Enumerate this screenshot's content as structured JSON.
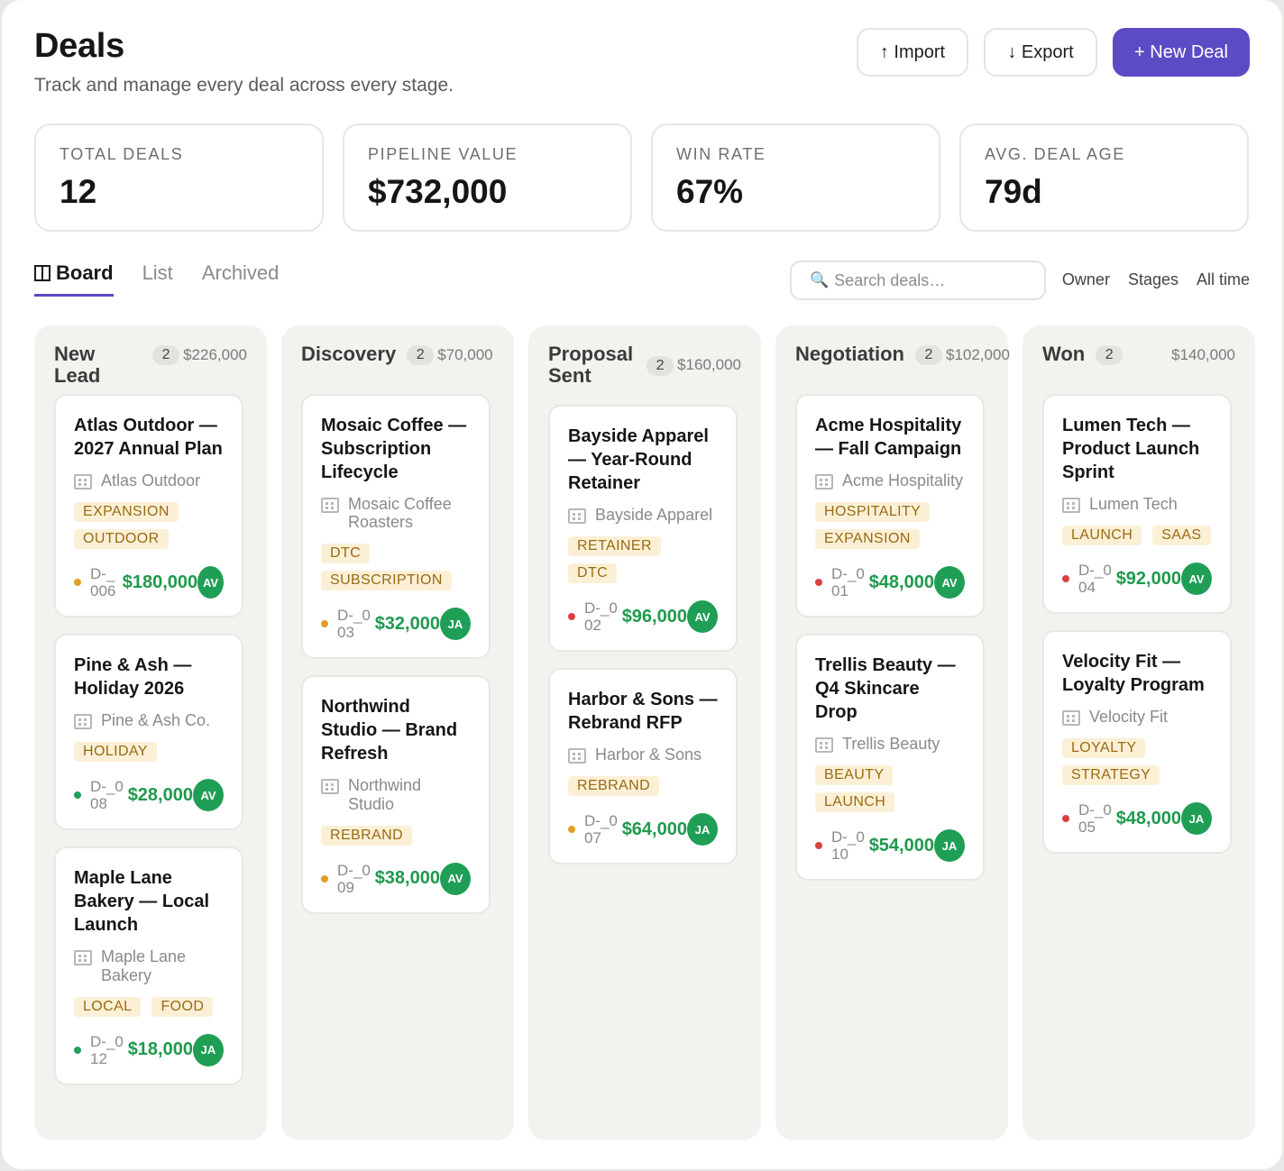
{
  "header": {
    "title": "Deals",
    "subtitle": "Track and manage every deal across every stage."
  },
  "actions": {
    "import_label": "↑ Import",
    "export_label": "↓ Export",
    "new_deal_label": "+ New Deal"
  },
  "stats": [
    {
      "label": "TOTAL DEALS",
      "value": "12"
    },
    {
      "label": "PIPELINE VALUE",
      "value": "$732,000"
    },
    {
      "label": "WIN RATE",
      "value": "67%"
    },
    {
      "label": "AVG. DEAL AGE",
      "value": "79d"
    }
  ],
  "tabs": [
    {
      "label": "Board",
      "active": true
    },
    {
      "label": "List",
      "active": false
    },
    {
      "label": "Archived",
      "active": false
    }
  ],
  "search": {
    "placeholder": "Search deals…"
  },
  "filters": [
    "Owner",
    "Stages",
    "All time"
  ],
  "colors": {
    "accent": "#5b4bc4",
    "money": "#1e9a4d",
    "tag_bg": "#fbf0d6",
    "tag_text": "#9a6a12"
  },
  "columns": [
    {
      "title": "New Lead",
      "count": "2",
      "amount": "$226,000",
      "cards": [
        {
          "title": "Atlas Outdoor — 2027 Annual Plan",
          "company": "Atlas Outdoor",
          "tags": [
            "EXPANSION",
            "OUTDOOR"
          ],
          "status": "yellow",
          "id": "D-_006",
          "amount": "$180,000",
          "owner": "AV"
        },
        {
          "title": "Pine & Ash — Holiday 2026",
          "company": "Pine & Ash Co.",
          "tags": [
            "HOLIDAY"
          ],
          "status": "green",
          "id": "D-_008",
          "amount": "$28,000",
          "owner": "AV"
        },
        {
          "title": "Maple Lane Bakery — Local Launch",
          "company": "Maple Lane Bakery",
          "tags": [
            "LOCAL",
            "FOOD"
          ],
          "status": "green",
          "id": "D-_012",
          "amount": "$18,000",
          "owner": "JA"
        }
      ]
    },
    {
      "title": "Discovery",
      "count": "2",
      "amount": "$70,000",
      "cards": [
        {
          "title": "Mosaic Coffee — Subscription Lifecycle",
          "company": "Mosaic Coffee Roasters",
          "tags": [
            "DTC",
            "SUBSCRIPTION"
          ],
          "status": "yellow",
          "id": "D-_003",
          "amount": "$32,000",
          "owner": "JA"
        },
        {
          "title": "Northwind Studio — Brand Refresh",
          "company": "Northwind Studio",
          "tags": [
            "REBRAND"
          ],
          "status": "yellow",
          "id": "D-_009",
          "amount": "$38,000",
          "owner": "AV"
        }
      ]
    },
    {
      "title": "Proposal Sent",
      "count": "2",
      "amount": "$160,000",
      "cards": [
        {
          "title": "Bayside Apparel — Year-Round Retainer",
          "company": "Bayside Apparel",
          "tags": [
            "RETAINER",
            "DTC"
          ],
          "status": "red",
          "id": "D-_002",
          "amount": "$96,000",
          "owner": "AV"
        },
        {
          "title": "Harbor & Sons — Rebrand RFP",
          "company": "Harbor & Sons",
          "tags": [
            "REBRAND"
          ],
          "status": "yellow",
          "id": "D-_007",
          "amount": "$64,000",
          "owner": "JA"
        }
      ]
    },
    {
      "title": "Negotiation",
      "count": "2",
      "amount": "$102,000",
      "cards": [
        {
          "title": "Acme Hospitality — Fall Campaign",
          "company": "Acme Hospitality",
          "tags": [
            "HOSPITALITY",
            "EXPANSION"
          ],
          "status": "red",
          "id": "D-_001",
          "amount": "$48,000",
          "owner": "AV"
        },
        {
          "title": "Trellis Beauty — Q4 Skincare Drop",
          "company": "Trellis Beauty",
          "tags": [
            "BEAUTY",
            "LAUNCH"
          ],
          "status": "red",
          "id": "D-_010",
          "amount": "$54,000",
          "owner": "JA"
        }
      ]
    },
    {
      "title": "Won",
      "count": "2",
      "amount": "$140,000",
      "cards": [
        {
          "title": "Lumen Tech — Product Launch Sprint",
          "company": "Lumen Tech",
          "tags": [
            "LAUNCH",
            "SAAS"
          ],
          "status": "red",
          "id": "D-_004",
          "amount": "$92,000",
          "owner": "AV"
        },
        {
          "title": "Velocity Fit — Loyalty Program",
          "company": "Velocity Fit",
          "tags": [
            "LOYALTY",
            "STRATEGY"
          ],
          "status": "red",
          "id": "D-_005",
          "amount": "$48,000",
          "owner": "JA"
        }
      ]
    }
  ]
}
